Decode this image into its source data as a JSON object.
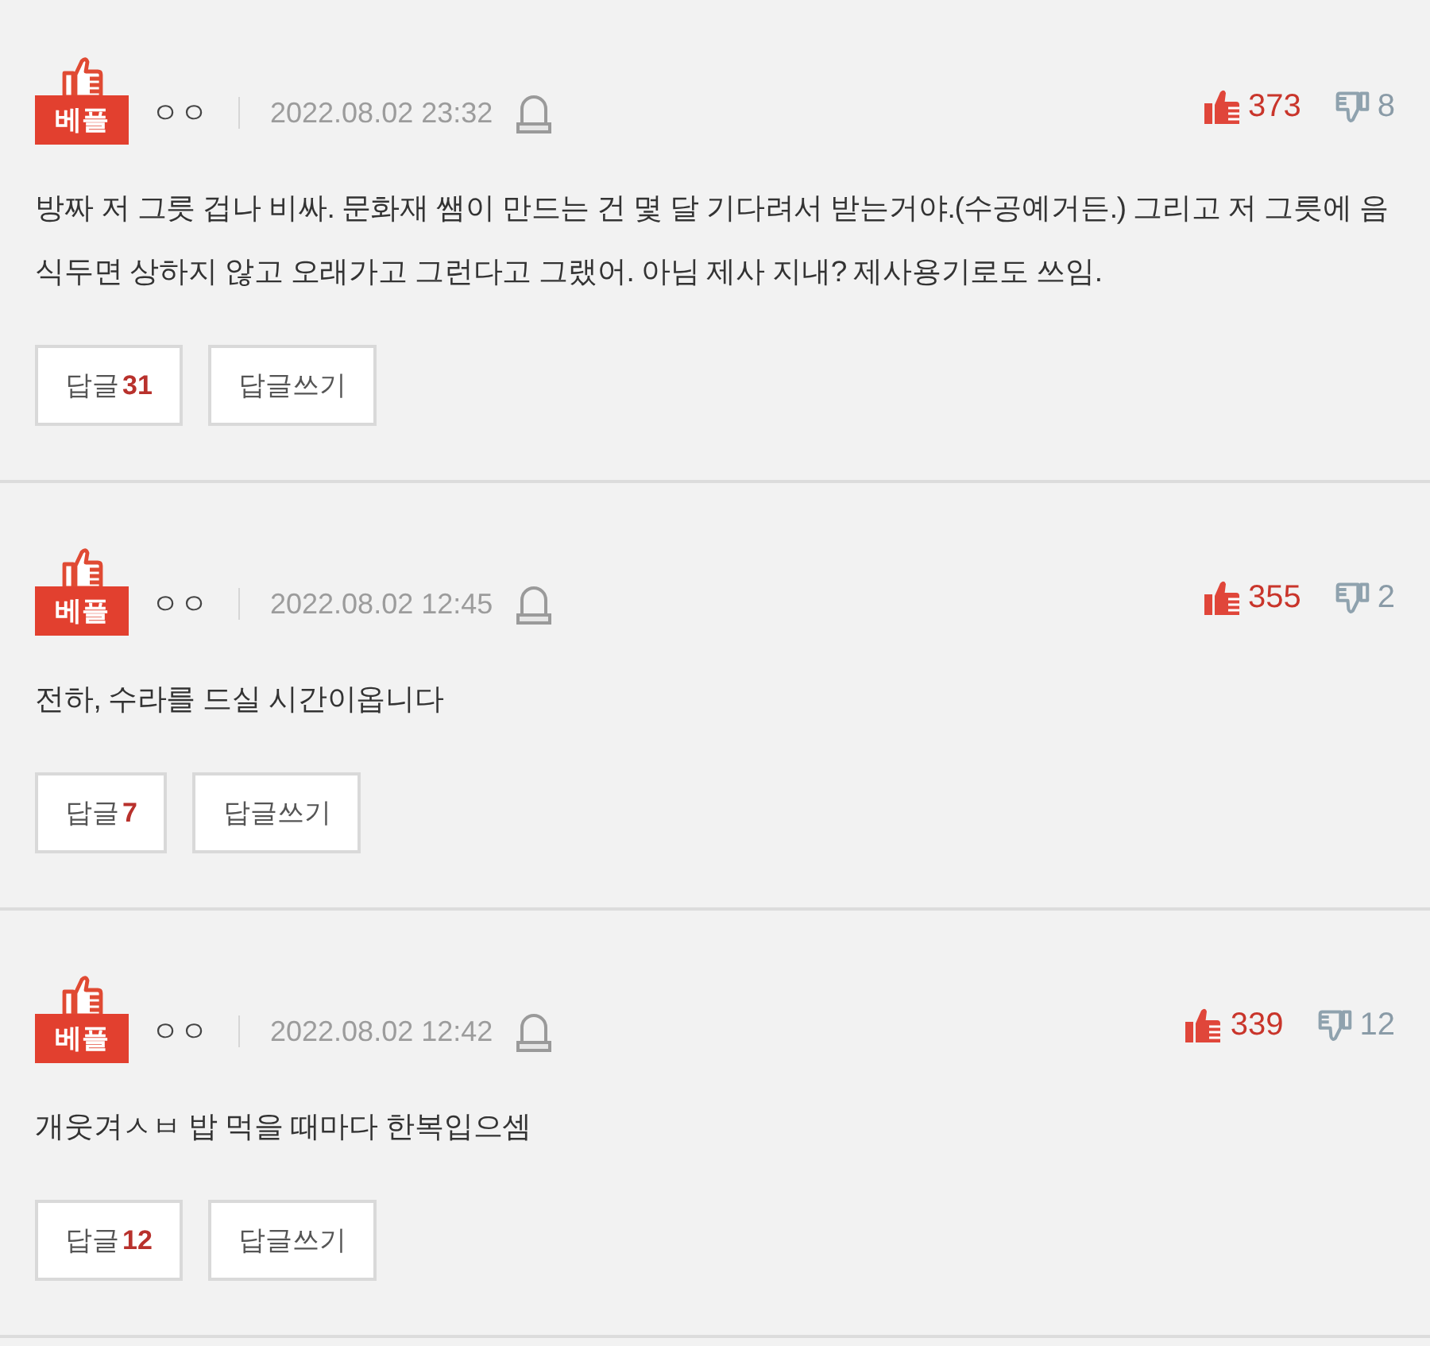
{
  "comments": [
    {
      "badge": "베플",
      "username": "ㅇㅇ",
      "date": "2022.08.02 23:32",
      "likes": "373",
      "dislikes": "8",
      "body": "방짜 저 그릇 겁나 비싸. 문화재 쌤이 만드는 건 몇 달 기다려서 받는거야.(수공예거든.) 그리고 저 그릇에 음식두면 상하지 않고 오래가고 그런다고 그랬어. 아님 제사 지내? 제사용기로도 쓰임.",
      "reply_button": {
        "label": "답글",
        "count": "31"
      },
      "write_reply_button": "답글쓰기"
    },
    {
      "badge": "베플",
      "username": "ㅇㅇ",
      "date": "2022.08.02 12:45",
      "likes": "355",
      "dislikes": "2",
      "body": "전하, 수라를 드실 시간이옵니다",
      "reply_button": {
        "label": "답글",
        "count": "7"
      },
      "write_reply_button": "답글쓰기"
    },
    {
      "badge": "베플",
      "username": "ㅇㅇ",
      "date": "2022.08.02 12:42",
      "likes": "339",
      "dislikes": "12",
      "body": "개웃겨ㅅㅂ 밥 먹을 때마다 한복입으셈",
      "reply_button": {
        "label": "답글",
        "count": "12"
      },
      "write_reply_button": "답글쓰기"
    }
  ]
}
